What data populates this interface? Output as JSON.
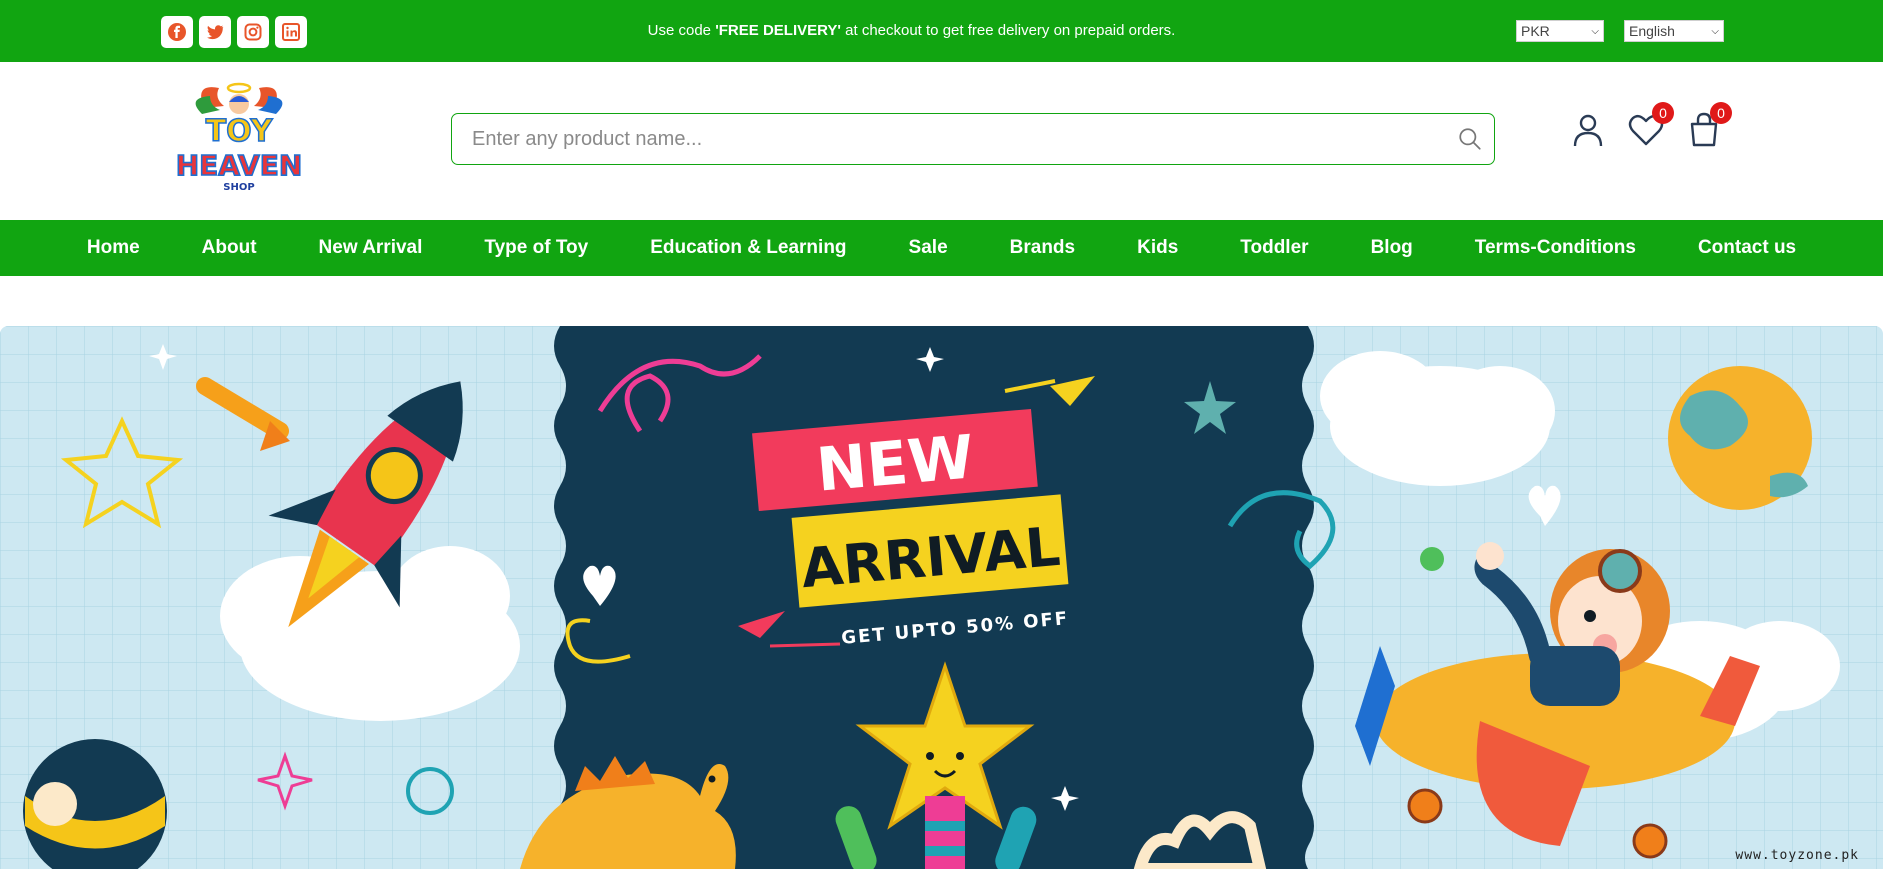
{
  "topbar": {
    "promo_prefix": "Use code ",
    "promo_code": "'FREE DELIVERY'",
    "promo_suffix": " at checkout to get free delivery on prepaid orders.",
    "currency": "PKR",
    "language": "English",
    "social": [
      "facebook-icon",
      "twitter-icon",
      "instagram-icon",
      "linkedin-icon"
    ],
    "social_color": "#e8552a",
    "bg_color": "#11a511"
  },
  "header": {
    "logo_line1": "TOY",
    "logo_line2": "HEAVEN",
    "logo_line3": "SHOP",
    "search_placeholder": "Enter any product name...",
    "wishlist_count": "0",
    "cart_count": "0"
  },
  "nav": {
    "items": [
      "Home",
      "About",
      "New Arrival",
      "Type of Toy",
      "Education & Learning",
      "Sale",
      "Brands",
      "Kids",
      "Toddler",
      "Blog",
      "Terms-Conditions",
      "Contact us"
    ]
  },
  "banner": {
    "headline_1": "NEW",
    "headline_2": "ARRIVAL",
    "subline": "GET UPTO 50% OFF",
    "watermark": "www.toyzone.pk"
  }
}
